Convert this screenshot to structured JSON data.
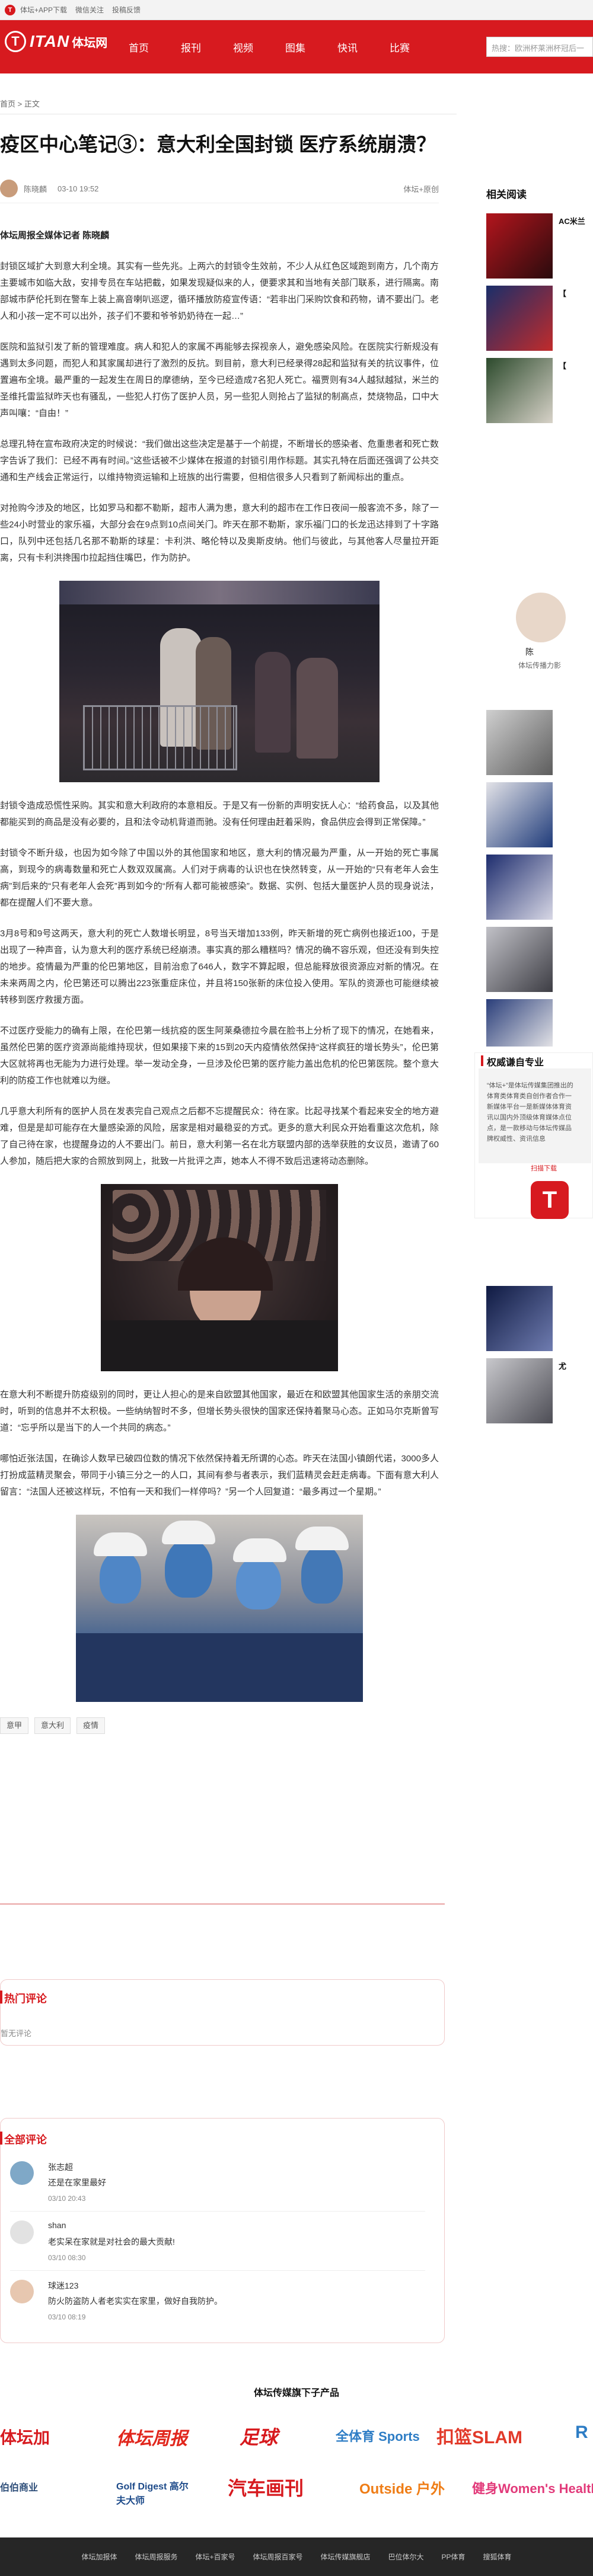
{
  "topbar": {
    "items": [
      "体坛+APP下载",
      "微信关注",
      "投稿反馈"
    ]
  },
  "header": {
    "logo": {
      "mark": "T",
      "word": "ITAN",
      "cn": "体坛网"
    },
    "nav": [
      "首页",
      "报刊",
      "视频",
      "图集",
      "快讯",
      "比赛"
    ],
    "search_placeholder": "热搜：欧洲杯莱洲杯冠后一"
  },
  "breadcrumb": "首页 > 正文",
  "article": {
    "title": "疫区中心笔记③：意大利全国封锁 医疗系统崩溃？",
    "author": "陈晓麟",
    "time": "03-10 19:52",
    "source": "体坛+原创",
    "byline": "体坛周报全媒体记者 陈晓麟",
    "paragraphs": [
      "封锁区域扩大到意大利全境。其实有一些先兆。上两六的封锁令生效前，不少人从红色区域跑到南方，几个南方主要城市如临大敌，安排专员在车站把截，如果发现疑似来的人，便要求其和当地有关部门联系，进行隔离。南部城市萨伦托到在警车上装上高音喇叭巡逻，循环播放防疫宣传语：“若非出门采购饮食和药物，请不要出门。老人和小孩一定不可以出外，孩子们不要和爷爷奶奶待在一起…”",
      "医院和监狱引发了新的管理难度。病人和犯人的家属不再能够去探视亲人，避免感染风险。在医院实行新规没有遇到太多问题，而犯人和其家属却进行了激烈的反抗。到目前，意大利已经录得28起和监狱有关的抗议事件，位置遍布全境。最严重的一起发生在周日的摩德纳，至今已经造成7名犯人死亡。福贾则有34人越狱越狱，米兰的圣维托雷监狱昨天也有骚乱，一些犯人打伤了医护人员，另一些犯人则抢占了监狱的制高点，焚烧物品，口中大声叫嚷：“自由！”",
      "总理孔特在宣布政府决定的时候说：“我们做出这些决定是基于一个前提，不断增长的感染者、危重患者和死亡数字告诉了我们：已经不再有时间。”这些话被不少媒体在报道的封锁引用作标题。其实孔特在后面还强调了公共交通和生产线会正常运行，以维持物资运输和上班族的出行需要，但相信很多人只看到了新闻标出的重点。",
      "对抢购今涉及的地区，比如罗马和都不勒斯，超市人满为患，意大利的超市在工作日夜间一般客流不多，除了一些24小时营业的家乐福，大部分会在9点到10点间关门。昨天在那不勒斯，家乐福门口的长龙迅达排到了十字路口，队列中还包括几名那不勒斯的球星：卡利洪、略伦特以及奥斯皮纳。他们与彼此，与其他客人尽量拉开距离，只有卡利洪搀围巾拉起挡住嘴巴，作为防护。",
      "封锁令造成恐慌性采购。其实和意大利政府的本意相反。于是又有一份新的声明安抚人心：“给药食品，以及其他都能买到的商品是没有必要的，且和法令动机背道而驰。没有任何理由赶着采购，食品供应会得到正常保障。”",
      "封锁令不断升级，也因为如今除了中国以外的其他国家和地区，意大利的情况最为严重，从一开始的死亡事属高，到现今的病毒数量和死亡人数双双属高。人们对于病毒的认识也在快然转变，从一开始的“只有老年人会生病”到后来的“只有老年人会死”再到如今的“所有人都可能被感染”。数据、实例、包括大量医护人员的现身说法，都在提醒人们不要大意。",
      "3月8号和9号这两天，意大利的死亡人数增长明显，8号当天增加133例，昨天新增的死亡病例也接近100，于是出现了一种声音，认为意大利的医疗系统已经崩溃。事实真的那么糟糕吗？情况的确不容乐观，但还没有到失控的地步。疫情最为严重的伦巴第地区，目前治愈了646人，数字不算起眼，但总能释放很资源应对新的情况。在未来两周之内，伦巴第还可以腾出223张重症床位，并且将150张新的床位投入使用。军队的资源也可能继续被转移到医疗救援方面。",
      "不过医疗受能力的确有上限，在伦巴第一线抗疫的医生阿莱桑德拉今晨在脸书上分析了现下的情况，在她看来，虽然伦巴第的医疗资源尚能维持现状，但如果接下来的15到20天内疫情依然保持“这样疯狂的增长势头”，伦巴第大区就将再也无能为力进行处理。举一发动全身，一旦涉及伦巴第的医疗能力盖出危机的伦巴第医院。整个意大利的防疫工作也就难以为继。",
      "几乎意大利所有的医护人员在发表完自己观点之后都不忘提醒民众：待在家。比起寻找某个看起来安全的地方避难，但是是却可能存在大量感染源的风险，居家是相对最稳妥的方式。更多的意大利民众开始看重这次危机，除了自己待在家，也提醒身边的人不要出门。前日，意大利第一名在北方联盟内部的选举获胜的女议员，邀请了60人参加，随后把大家的合照放到网上，批致一片批评之声，她本人不得不致后迅速将动态删除。",
      "在意大利不断提升防疫级别的同时，更让人担心的是来自欧盟其他国家，最近在和欧盟其他国家生活的亲朋交流时，听到的信息并不太积极。一些纳纳智时不多，但增长势头很快的国家还保持着聚马心态。正如马尔克斯曾写道：“忘乎所以是当下的人一个共同的病态。”",
      "哪怕近张法国，在确诊人数早已破四位数的情况下依然保持着无所谓的心态。昨天在法国小镇朗代诺，3000多人打扮成蓝精灵聚会，带同于小镇三分之一的人口，其间有参与者表示，我们蓝精灵会赶走病毒。下面有意大利人留言：“法国人还被这样玩，不怕有一天和我们一样停吗？”另一个人回复道：“最多再过一个星期。”"
    ],
    "tags": [
      "意甲",
      "意大利",
      "疫情"
    ]
  },
  "sidebar": {
    "related_title": "相关阅读",
    "related": [
      "AC米兰",
      "【",
      "【",
      "",
      "",
      "",
      "",
      "",
      "",
      "尤"
    ],
    "author_name": "陈",
    "author_desc": "体坛传播力影"
  },
  "ad": {
    "title": "权威谦自专业",
    "desc": "“体坛+”是体坛传媒集团推出的体育类体育类自创作者合作一新媒体平台一是新媒体体育资讯以国内外顶级体育媒体点位点，是一款移动与体坛传媒品牌权威性、资讯信息",
    "cta": "扫描下载",
    "app_mark": "T"
  },
  "comments": {
    "hot_title": "热门评论",
    "hot_empty": "暂无评论",
    "all_title": "全部评论",
    "items": [
      {
        "name": "张志超",
        "text": "还是在家里最好",
        "time": "03/10 20:43"
      },
      {
        "name": "shan",
        "text": "老实呆在家就是对社会的最大贡献!",
        "time": "03/10 08:30"
      },
      {
        "name": "球迷123",
        "text": "防火防盗防人者老实实在家里，做好自我防护。",
        "time": "03/10 08:19"
      }
    ]
  },
  "footer": {
    "products_title": "体坛传媒旗下子产品",
    "brands": [
      "体坛加",
      "体坛周报",
      "足球",
      "全体育 Sports",
      "扣篮SLAM",
      "R",
      "伯伯商业",
      "Golf Digest 高尔夫大师",
      "汽车画刊",
      "Outside 户外",
      "健身Women's Health"
    ],
    "links": [
      "体坛加报体",
      "体坛周报服务",
      "体坛+百家号",
      "体坛周报百家号",
      "体坛传媒旗舰店",
      "巴位体尔大",
      "PP体育",
      "搜狐体育"
    ]
  },
  "colors": {
    "brand_red": "#d71a1f",
    "footer_bg": "#262626"
  }
}
